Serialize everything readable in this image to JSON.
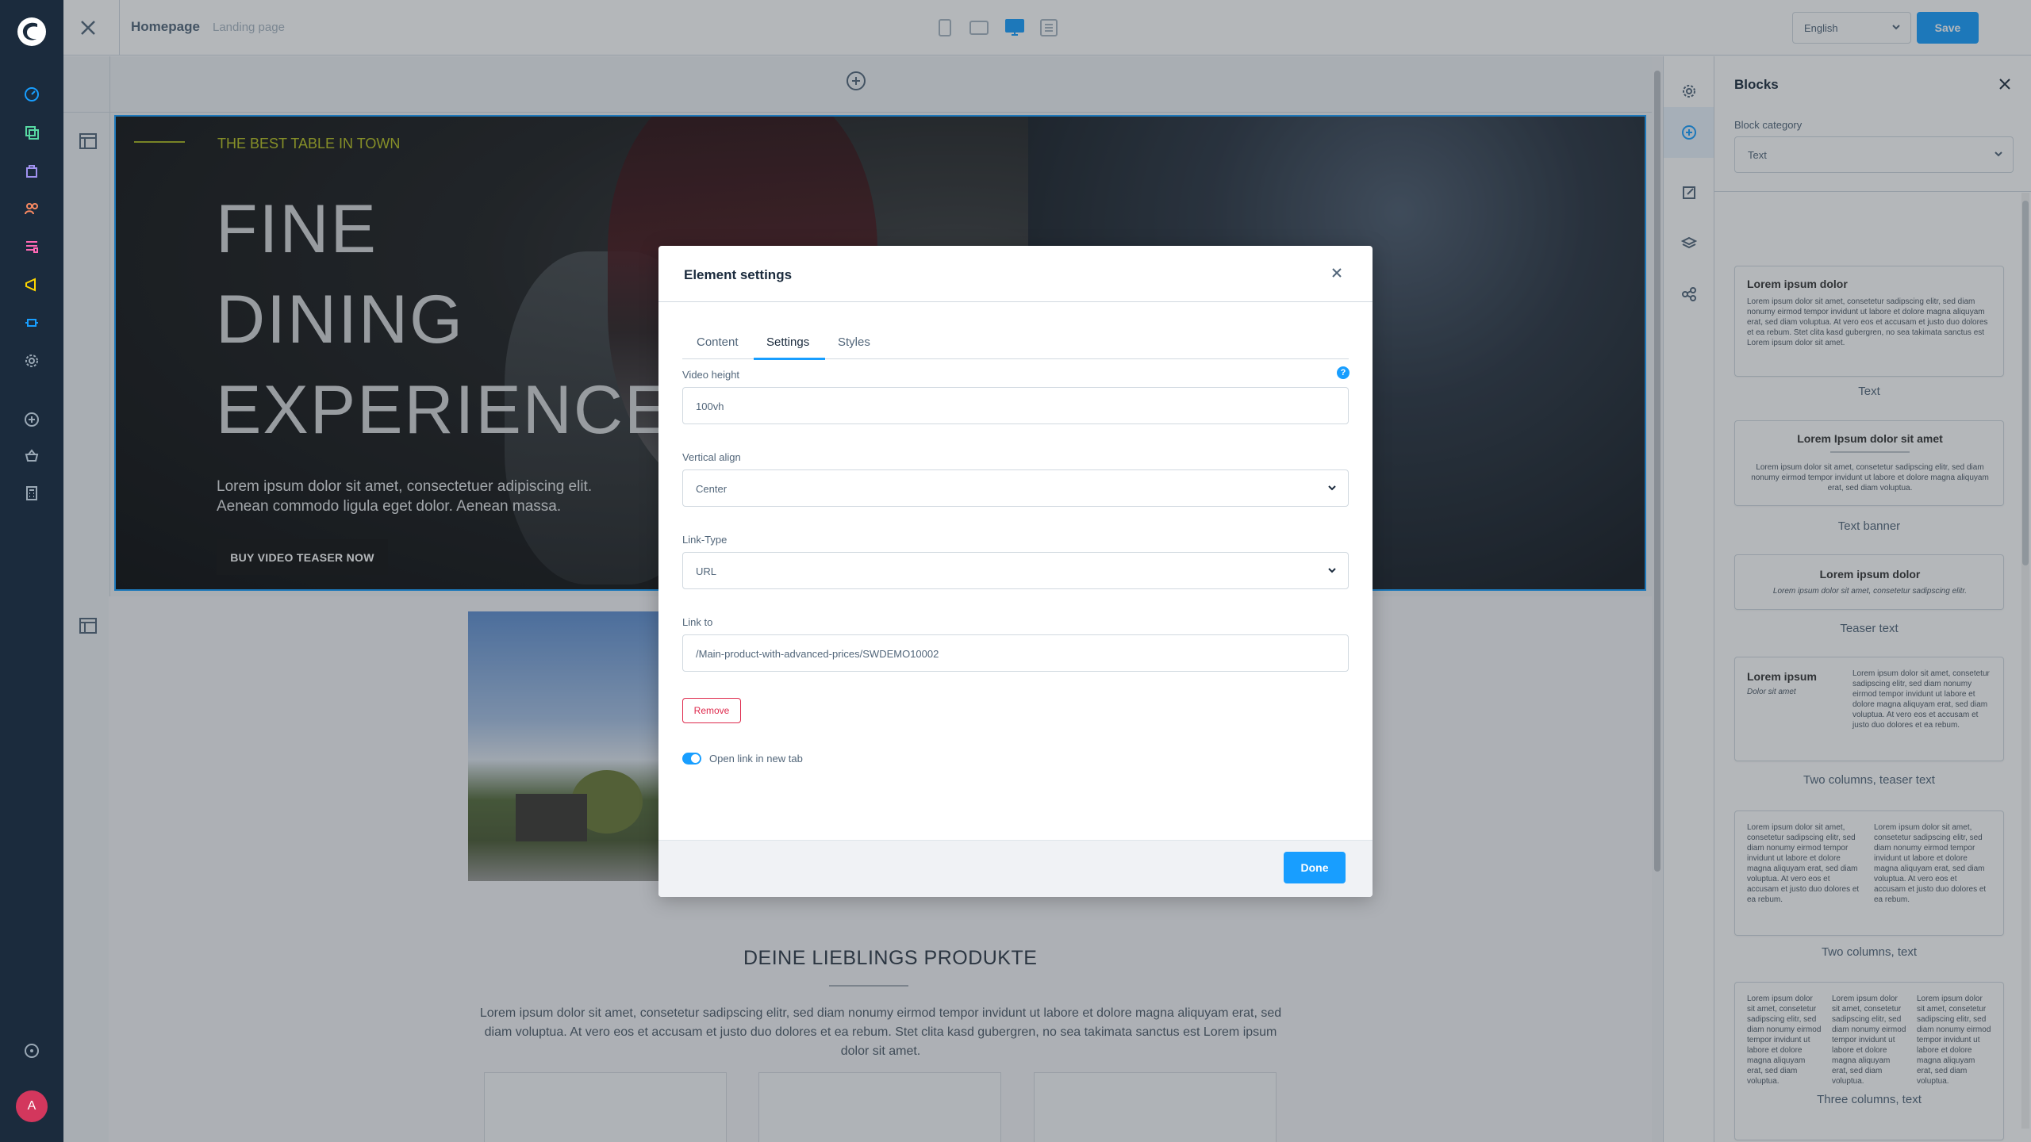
{
  "topbar": {
    "page_name": "Homepage",
    "page_type": "Landing page",
    "language": "English",
    "save_label": "Save"
  },
  "hero": {
    "tagline": "THE BEST TABLE IN TOWN",
    "headline_1": "FINE",
    "headline_2": "DINING",
    "headline_3": "EXPERIENCE",
    "body": "Lorem ipsum dolor sit amet, consectetuer adipiscing elit. Aenean commodo ligula eget dolor. Aenean massa.",
    "cta": "BUY VIDEO TEASER NOW"
  },
  "products": {
    "title": "DEINE LIEBLINGS PRODUKTE",
    "text": "Lorem ipsum dolor sit amet, consetetur sadipscing elitr, sed diam nonumy eirmod tempor invidunt ut labore et dolore magna aliquyam erat, sed diam voluptua. At vero eos et accusam et justo duo dolores et ea rebum. Stet clita kasd gubergren, no sea takimata sanctus est Lorem ipsum dolor sit amet."
  },
  "modal": {
    "title": "Element settings",
    "tabs": [
      "Content",
      "Settings",
      "Styles"
    ],
    "active_tab": "Settings",
    "video_height_label": "Video height",
    "video_height_value": "100vh",
    "help_icon": "?",
    "vertical_align_label": "Vertical align",
    "vertical_align_value": "Center",
    "link_type_label": "Link-Type",
    "link_type_value": "URL",
    "link_to_label": "Link to",
    "link_to_value": "/Main-product-with-advanced-prices/SWDEMO10002",
    "remove_label": "Remove",
    "open_new_tab_label": "Open link in new tab",
    "open_new_tab_enabled": true,
    "done_label": "Done"
  },
  "blocks_panel": {
    "title": "Blocks",
    "category_label": "Block category",
    "category_value": "Text",
    "blocks": [
      {
        "name": "Text",
        "heading": "Lorem ipsum dolor",
        "text": "Lorem ipsum dolor sit amet, consetetur sadipscing elitr, sed diam nonumy eirmod tempor invidunt ut labore et dolore magna aliquyam erat, sed diam voluptua. At vero eos et accusam et justo duo dolores et ea rebum. Stet clita kasd gubergren, no sea takimata sanctus est Lorem ipsum dolor sit amet."
      },
      {
        "name": "Text banner",
        "heading": "Lorem Ipsum dolor sit amet",
        "text": "Lorem ipsum dolor sit amet, consetetur sadipscing elitr, sed diam nonumy eirmod tempor invidunt ut labore et dolore magna aliquyam erat, sed diam voluptua."
      },
      {
        "name": "Teaser text",
        "heading": "Lorem ipsum dolor",
        "text": "Lorem ipsum dolor sit amet, consetetur sadipscing elitr."
      },
      {
        "name": "Two columns, teaser text",
        "heading": "Lorem ipsum",
        "subheading": "Dolor sit amet",
        "text": "Lorem ipsum dolor sit amet, consetetur sadipscing elitr, sed diam nonumy eirmod tempor invidunt ut labore et dolore magna aliquyam erat, sed diam voluptua. At vero eos et accusam et justo duo dolores et ea rebum."
      },
      {
        "name": "Two columns, text",
        "text": "Lorem ipsum dolor sit amet, consetetur sadipscing elitr, sed diam nonumy eirmod tempor invidunt ut labore et dolore magna aliquyam erat, sed diam voluptua. At vero eos et accusam et justo duo dolores et ea rebum."
      },
      {
        "name": "Three columns, text",
        "text": "Lorem ipsum dolor sit amet, consetetur sadipscing elitr, sed diam nonumy eirmod tempor invidunt ut labore et dolore magna aliquyam erat, sed diam voluptua."
      }
    ]
  },
  "colors": {
    "brand_blue": "#189eff",
    "sidebar_dark": "#1b2b3d",
    "danger": "#de294c",
    "accent_green": "#b8c21f"
  },
  "icons": {
    "admin_nav": [
      "dashboard-icon",
      "catalogue-icon",
      "orders-icon",
      "customers-icon",
      "content-icon",
      "marketing-icon",
      "extensions-icon",
      "settings-icon",
      "add-icon",
      "shop-icon",
      "calculator-icon",
      "help-icon"
    ],
    "right_sidebar": [
      "settings-icon",
      "add-block-icon",
      "edit-icon",
      "layers-icon",
      "share-icon"
    ]
  }
}
